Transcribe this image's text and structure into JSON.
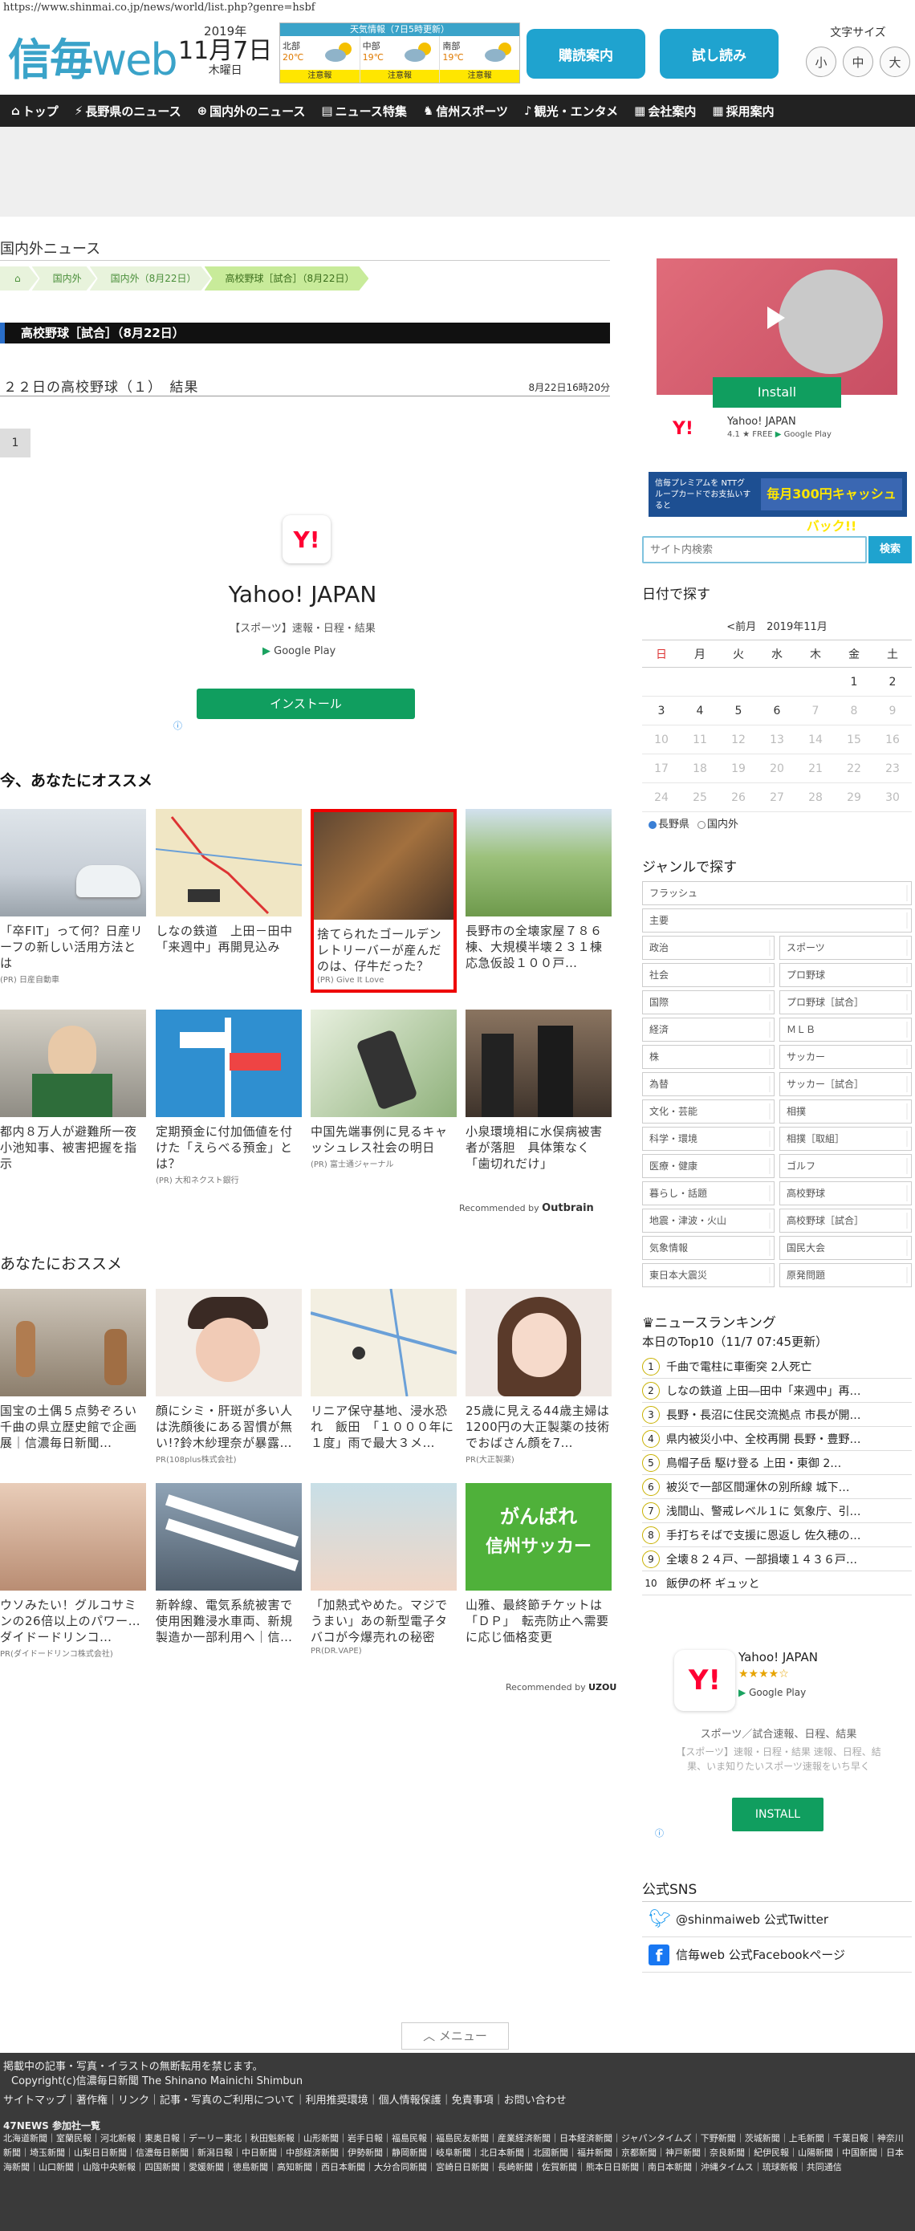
{
  "browser": {
    "url": "https://www.shinmai.co.jp/news/world/list.php?genre=hsbf"
  },
  "header": {
    "logo_main": "信毎",
    "logo_sub": "web",
    "year": "2019年",
    "month_day": "11月7日",
    "weekday": "木曜日",
    "weather": {
      "title": "天気情報（7日5時更新）",
      "regions": [
        {
          "name": "北部",
          "temp": "20℃",
          "warn": "注意報"
        },
        {
          "name": "中部",
          "temp": "19℃",
          "warn": "注意報"
        },
        {
          "name": "南部",
          "temp": "19℃",
          "warn": "注意報"
        }
      ]
    },
    "subscribe_button": "購読案内",
    "trial_button": "試し読み",
    "font_size_label": "文字サイズ",
    "font_sizes": [
      "小",
      "中",
      "大"
    ]
  },
  "nav": {
    "items": [
      "トップ",
      "長野県のニュース",
      "国内外のニュース",
      "ニュース特集",
      "信州スポーツ",
      "観光・エンタメ",
      "会社案内",
      "採用案内"
    ]
  },
  "main": {
    "section_title": "国内外ニュース",
    "breadcrumb": [
      "国内外（8月22日）",
      "高校野球［試合］（8月22日）"
    ],
    "breadcrumb_home": "国内外",
    "category_bar": "高校野球［試合］（8月22日）",
    "headline": "２２日の高校野球（１）　結果",
    "headline_time": "8月22日16時20分",
    "page_number": "1",
    "yahoo_ad": {
      "logo": "Y!",
      "title": "Yahoo! JAPAN",
      "subtitle": "【スポーツ】速報・日程・結果",
      "store": "Google Play",
      "install": "インストール",
      "adchoices": "ⓘ"
    },
    "recommend_title": "今、あなたにオススメ",
    "recommend_cards": [
      {
        "text": "「卒FIT」って何？日産リーフの新しい活用方法とは",
        "pr": "(PR) 日産自動車"
      },
      {
        "text": "しなの鉄道　上田－田中「来週中」再開見込み",
        "pr": ""
      },
      {
        "text": "捨てられたゴールデンレトリーバーが産んだのは、仔牛だった？",
        "pr": "(PR) Give It Love"
      },
      {
        "text": "長野市の全壊家屋７８６棟、大規模半壊２３１棟　応急仮設１００戸…",
        "pr": ""
      },
      {
        "text": "都内８万人が避難所一夜　小池知事、被害把握を指示",
        "pr": ""
      },
      {
        "text": "定期預金に付加価値を付けた「えらべる預金」とは？",
        "pr": "(PR) 大和ネクスト銀行"
      },
      {
        "text": "中国先端事例に見るキャッシュレス社会の明日",
        "pr": "(PR) 富士通ジャーナル"
      },
      {
        "text": "小泉環境相に水俣病被害者が落胆　具体策なく「歯切れだけ」",
        "pr": ""
      }
    ],
    "outbrain_label": "Recommended by",
    "outbrain_brand": "Outbrain",
    "recommend2_title": "あなたにおススメ",
    "recommend2_cards": [
      {
        "text": "国宝の土偶５点勢ぞろい　千曲の県立歴史館で企画展｜信濃毎日新聞…",
        "pr": ""
      },
      {
        "text": "顔にシミ・肝斑が多い人は洗顔後にある習慣が無い!?鈴木紗理奈が暴露…",
        "pr": "PR(108plus株式会社)"
      },
      {
        "text": "リニア保守基地、浸水恐れ　飯田　「１０００年に１度」雨で最大３メ…",
        "pr": ""
      },
      {
        "text": "25歳に見える44歳主婦は1200円の大正製薬の技術でおばさん顔を7…",
        "pr": "PR(大正製薬)"
      },
      {
        "text": "ウソみたい！グルコサミンの26倍以上のパワー…ダイドードリンコ…",
        "pr": "PR(ダイドードリンコ株式会社)"
      },
      {
        "text": "新幹線、電気系統被害で使用困難浸水車両、新規製造か一部利用へ｜信…",
        "pr": ""
      },
      {
        "text": "「加熱式やめた。マジでうまい」あの新型電子タバコが今爆売れの秘密",
        "pr": "PR(DR.VAPE)"
      },
      {
        "text": "山雅、最終節チケットは「ＤＰ」　転売防止へ需要に応じ価格変更",
        "pr": ""
      }
    ],
    "thumb_soccer_line1": "がんばれ",
    "thumb_soccer_line2": "信州サッカー",
    "uzou_label": "Recommended by",
    "uzou_brand": "UZOU"
  },
  "sidebar": {
    "video_ad": {
      "install": "Install",
      "app": "Yahoo! JAPAN",
      "rating": "4.1 ★ FREE",
      "store": "Google Play"
    },
    "premium_banner": {
      "left": "信毎プレミアムを NTTグループカードでお支払いすると",
      "right": "毎月300円キャッシュバック!!"
    },
    "search_placeholder": "サイト内検索",
    "search_button": "検索",
    "date_title": "日付で探す",
    "calendar": {
      "prev": "<前月",
      "month": "2019年11月",
      "weekdays": [
        "日",
        "月",
        "火",
        "水",
        "木",
        "金",
        "土"
      ],
      "weeks": [
        [
          "",
          "",
          "",
          "",
          "",
          "1",
          "2"
        ],
        [
          "3",
          "4",
          "5",
          "6",
          "7",
          "8",
          "9"
        ],
        [
          "10",
          "11",
          "12",
          "13",
          "14",
          "15",
          "16"
        ],
        [
          "17",
          "18",
          "19",
          "20",
          "21",
          "22",
          "23"
        ],
        [
          "24",
          "25",
          "26",
          "27",
          "28",
          "29",
          "30"
        ]
      ]
    },
    "radio": [
      "長野県",
      "国内外"
    ],
    "genre_title": "ジャンルで探す",
    "genres_single": [
      "フラッシュ",
      "主要"
    ],
    "genres_pairs": [
      [
        "政治",
        "スポーツ"
      ],
      [
        "社会",
        "プロ野球"
      ],
      [
        "国際",
        "プロ野球［試合］"
      ],
      [
        "経済",
        "ＭＬＢ"
      ],
      [
        "株",
        "サッカー"
      ],
      [
        "為替",
        "サッカー［試合］"
      ],
      [
        "文化・芸能",
        "相撲"
      ],
      [
        "科学・環境",
        "相撲［取組］"
      ],
      [
        "医療・健康",
        "ゴルフ"
      ],
      [
        "暮らし・話題",
        "高校野球"
      ],
      [
        "地震・津波・火山",
        "高校野球［試合］"
      ],
      [
        "気象情報",
        "国民大会"
      ],
      [
        "東日本大震災",
        "原発問題"
      ]
    ],
    "ranking_title": "ニュースランキング",
    "ranking_sub": "本日のTop10（11/7 07:45更新）",
    "ranking": [
      "千曲で電柱に車衝突 2人死亡",
      "しなの鉄道 上田―田中「来週中」再…",
      "長野・長沼に住民交流拠点 市長が開…",
      "県内被災小中、全校再開 長野・豊野…",
      "鳥帽子岳 駆け登る 上田・東御 2…",
      "被災で一部区間運休の別所線 城下…",
      "浅間山、警戒レベル１に 気象庁、引…",
      "手打ちそばで支援に恩返し 佐久穂の…",
      "全壊８２４戸、一部損壊１４３６戸…",
      "飯伊の杯 ギュッと"
    ],
    "yahoo_ad2": {
      "logo": "Y!",
      "name": "Yahoo! JAPAN",
      "stars": "★★★★☆",
      "store": "Google Play",
      "desc1": "スポーツ／試合速報、日程、結果",
      "desc2": "【スポーツ】速報・日程・結果 速報、日程、結果、いま知りたいスポーツ速報をいち早く",
      "install": "INSTALL"
    },
    "sns_title": "公式SNS",
    "twitter": "@shinmaiweb 公式Twitter",
    "facebook": "信毎web 公式Facebookページ"
  },
  "footer": {
    "menu_button": "メニュー",
    "notice": "掲載中の記事・写真・イラストの無断転用を禁じます。",
    "copyright": "Copyright(c)信濃毎日新聞 The Shinano Mainichi Shimbun",
    "links": "サイトマップ｜著作権｜リンク｜記事・写真のご利用について｜利用推奨環境｜個人情報保護｜免責事項｜お問い合わせ",
    "net_title": "47NEWS 参加社一覧",
    "net_list": "北海道新聞｜室蘭民報｜河北新報｜東奥日報｜デーリー東北｜秋田魁新報｜山形新聞｜岩手日報｜福島民報｜福島民友新聞｜産業経済新聞｜日本経済新聞｜ジャパンタイムズ｜下野新聞｜茨城新聞｜上毛新聞｜千葉日報｜神奈川新聞｜埼玉新聞｜山梨日日新聞｜信濃毎日新聞｜新潟日報｜中日新聞｜中部経済新聞｜伊勢新聞｜静岡新聞｜岐阜新聞｜北日本新聞｜北國新聞｜福井新聞｜京都新聞｜神戸新聞｜奈良新聞｜紀伊民報｜山陽新聞｜中国新聞｜日本海新聞｜山口新聞｜山陰中央新報｜四国新聞｜愛媛新聞｜徳島新聞｜高知新聞｜西日本新聞｜大分合同新聞｜宮崎日日新聞｜長崎新聞｜佐賀新聞｜熊本日日新聞｜南日本新聞｜沖縄タイムス｜琉球新報｜共同通信"
  }
}
